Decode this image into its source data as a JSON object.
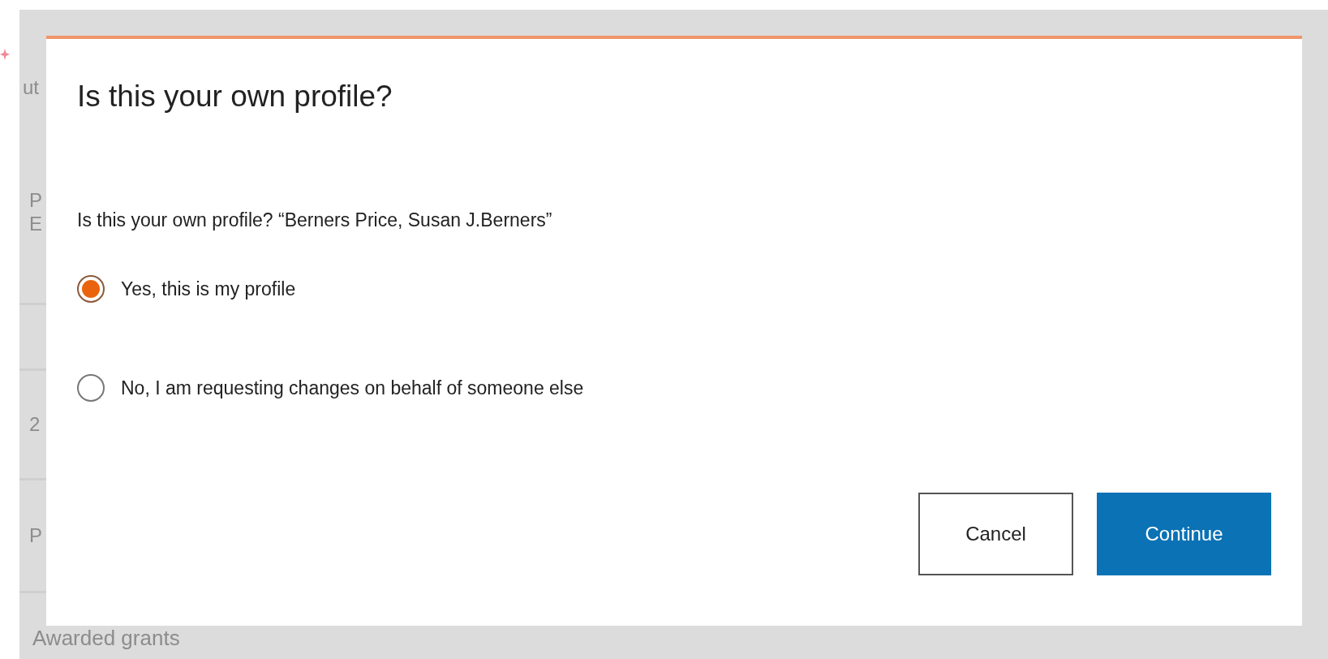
{
  "background": {
    "fragments": [
      "ut",
      "P",
      "E",
      "2",
      "P"
    ],
    "section_heading": "Awarded grants"
  },
  "dialog": {
    "title": "Is this your own profile?",
    "question": "Is this your own profile? “Berners Price, Susan J.Berners”",
    "options": [
      {
        "label": "Yes, this is my profile",
        "selected": true
      },
      {
        "label": "No, I am requesting changes on behalf of someone else",
        "selected": false
      }
    ],
    "buttons": [
      {
        "label": "Cancel",
        "kind": "secondary"
      },
      {
        "label": "Continue",
        "kind": "primary"
      }
    ]
  }
}
